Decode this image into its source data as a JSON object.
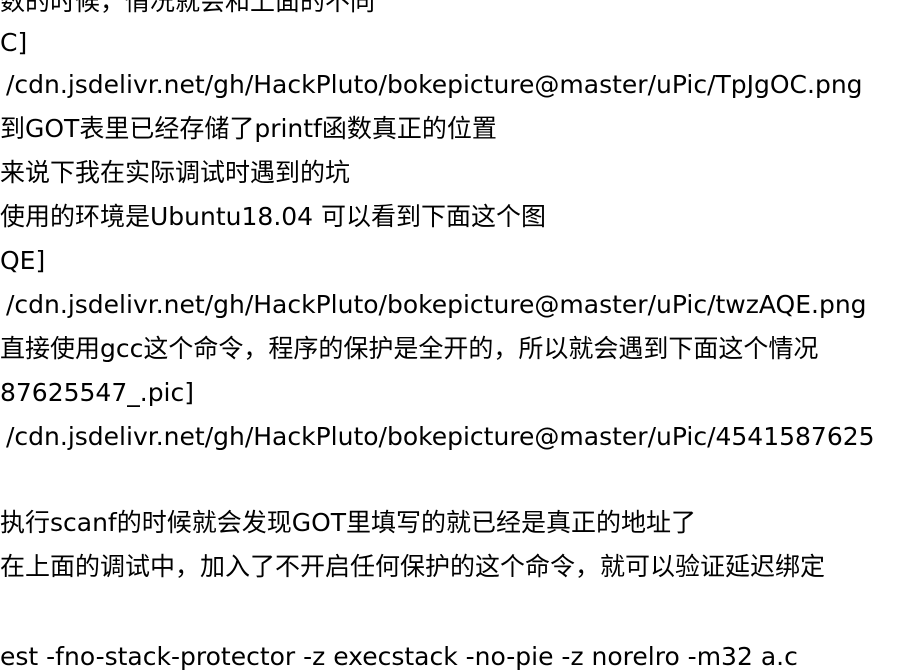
{
  "document": {
    "lines": [
      "数的时候，情况就会和上面的不同",
      "C]",
      "/cdn.jsdelivr.net/gh/HackPluto/bokepicture@master/uPic/TpJgOC.png",
      "到GOT表里已经存储了printf函数真正的位置",
      "来说下我在实际调试时遇到的坑",
      "使用的环境是Ubuntu18.04 可以看到下面这个图",
      "QE]",
      "/cdn.jsdelivr.net/gh/HackPluto/bokepicture@master/uPic/twzAQE.png",
      "直接使用gcc这个命令，程序的保护是全开的，所以就会遇到下面这个情况",
      "87625547_.pic]",
      "/cdn.jsdelivr.net/gh/HackPluto/bokepicture@master/uPic/4541587625",
      "执行scanf的时候就会发现GOT里填写的就已经是真正的地址了",
      "在上面的调试中，加入了不开启任何保护的这个命令，就可以验证延迟绑定",
      "est -fno-stack-protector -z execstack -no-pie -z norelro -m32 a.c"
    ]
  }
}
